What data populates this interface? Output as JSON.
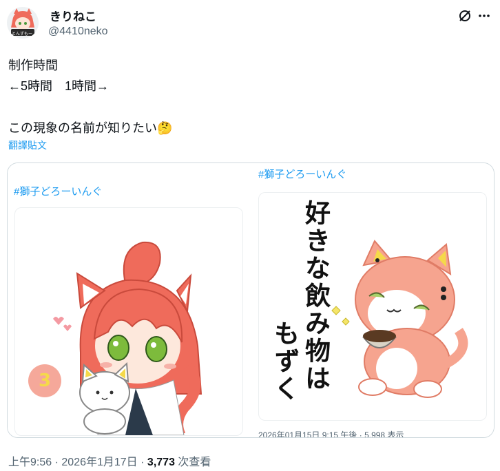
{
  "author": {
    "display_name": "きりねこ",
    "handle": "@4410neko",
    "avatar_badge": "とんずもー"
  },
  "header_icons": [
    "grok-icon",
    "more-icon"
  ],
  "tweet": {
    "lines": [
      "制作時間",
      "←5時間　1時間→",
      "",
      "この現象の名前が知りたい"
    ],
    "emoji": "🤔",
    "translate_label": "翻譯貼文"
  },
  "media": {
    "left": {
      "hashtag": "#獅子どろーいんぐ",
      "badge_number": "3"
    },
    "right": {
      "hashtag": "#獅子どろーいんぐ",
      "vertical_text_col1": "好きな飲み物は",
      "vertical_text_col2": "もずく",
      "footer_text": "2026年01月15日 9:15 午後 · 5,998 表示"
    }
  },
  "footer": {
    "time": "上午9:56",
    "date": "2026年1月17日",
    "view_count": "3,773",
    "view_label": "次查看",
    "separator": "·"
  },
  "colors": {
    "link": "#1d9bf0",
    "secondary": "#536471",
    "hair": "#ef6b5b",
    "cat": "#f6a48f"
  }
}
